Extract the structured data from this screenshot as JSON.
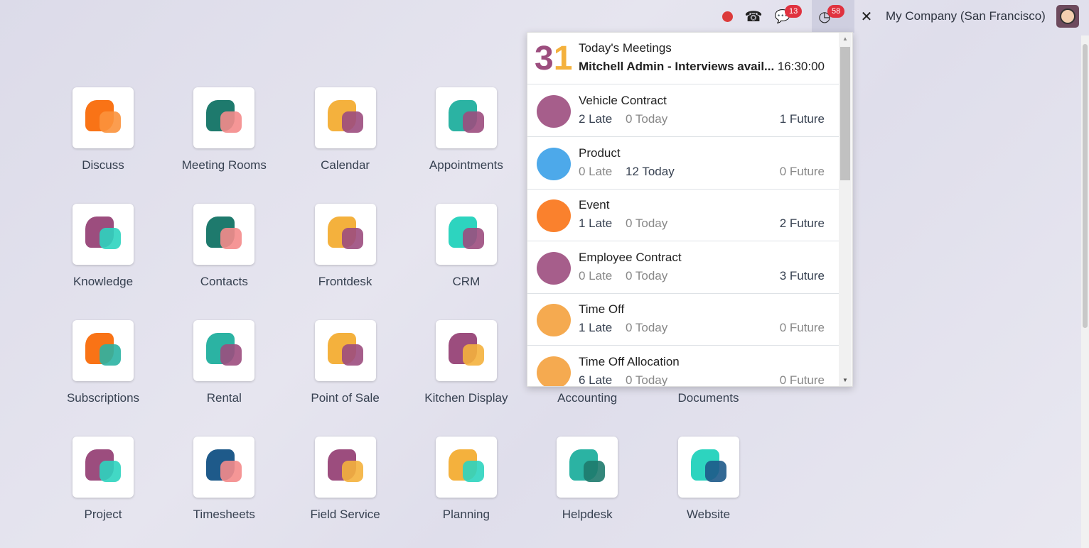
{
  "topbar": {
    "chat_badge": "13",
    "activity_badge": "58",
    "company": "My Company (San Francisco)",
    "icons": [
      "recording-dot-icon",
      "phone-icon",
      "chat-icon",
      "clock-icon",
      "tools-icon"
    ]
  },
  "apps": [
    {
      "label": "Discuss",
      "icon": "discuss-icon"
    },
    {
      "label": "Meeting Rooms",
      "icon": "meeting-rooms-icon"
    },
    {
      "label": "Calendar",
      "icon": "calendar-icon"
    },
    {
      "label": "Appointments",
      "icon": "appointments-icon"
    },
    {
      "label": "Knowledge",
      "icon": "knowledge-icon"
    },
    {
      "label": "Contacts",
      "icon": "contacts-icon"
    },
    {
      "label": "Frontdesk",
      "icon": "frontdesk-icon"
    },
    {
      "label": "CRM",
      "icon": "crm-icon"
    },
    {
      "label": "Subscriptions",
      "icon": "subscriptions-icon"
    },
    {
      "label": "Rental",
      "icon": "rental-icon"
    },
    {
      "label": "Point of Sale",
      "icon": "pos-icon"
    },
    {
      "label": "Kitchen Display",
      "icon": "kitchen-icon"
    },
    {
      "label": "Accounting",
      "icon": "accounting-icon"
    },
    {
      "label": "Documents",
      "icon": "documents-icon"
    },
    {
      "label": "Project",
      "icon": "project-icon"
    },
    {
      "label": "Timesheets",
      "icon": "timesheets-icon"
    },
    {
      "label": "Field Service",
      "icon": "field-service-icon"
    },
    {
      "label": "Planning",
      "icon": "planning-icon"
    },
    {
      "label": "Helpdesk",
      "icon": "helpdesk-icon"
    },
    {
      "label": "Website",
      "icon": "website-icon"
    }
  ],
  "activities": {
    "meeting": {
      "title": "Today's Meetings",
      "summary": "Mitchell Admin - Interviews avail...",
      "time": "16:30:00"
    },
    "rows": [
      {
        "title": "Vehicle Contract",
        "late": "2 Late",
        "today": "0 Today",
        "future": "1 Future"
      },
      {
        "title": "Product",
        "late": "0 Late",
        "today": "12 Today",
        "future": "0 Future"
      },
      {
        "title": "Event",
        "late": "1 Late",
        "today": "0 Today",
        "future": "2 Future"
      },
      {
        "title": "Employee Contract",
        "late": "0 Late",
        "today": "0 Today",
        "future": "3 Future"
      },
      {
        "title": "Time Off",
        "late": "1 Late",
        "today": "0 Today",
        "future": "0 Future"
      },
      {
        "title": "Time Off Allocation",
        "late": "6 Late",
        "today": "0 Today",
        "future": "0 Future"
      }
    ]
  }
}
